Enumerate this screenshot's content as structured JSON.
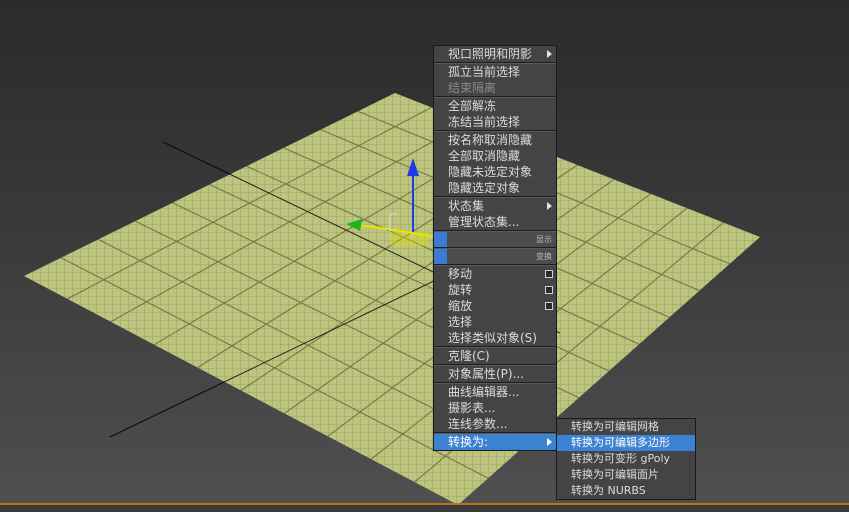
{
  "quad_menu": {
    "group1": [
      {
        "label": "视口照明和阴影",
        "submenu": true,
        "disabled": false
      }
    ],
    "group2": [
      {
        "label": "孤立当前选择",
        "disabled": false
      },
      {
        "label": "结束隔离",
        "disabled": true
      }
    ],
    "group3": [
      {
        "label": "全部解冻",
        "disabled": false
      },
      {
        "label": "冻结当前选择",
        "disabled": false
      }
    ],
    "group4": [
      {
        "label": "按名称取消隐藏",
        "disabled": false
      },
      {
        "label": "全部取消隐藏",
        "disabled": false
      },
      {
        "label": "隐藏未选定对象",
        "disabled": false
      },
      {
        "label": "隐藏选定对象",
        "disabled": false
      }
    ],
    "group5": [
      {
        "label": "状态集",
        "submenu": true,
        "disabled": false
      },
      {
        "label": "管理状态集...",
        "disabled": false
      }
    ],
    "display_header": "显示",
    "transform_header": "变换",
    "transform_items": [
      {
        "label": "移动",
        "options": true
      },
      {
        "label": "旋转",
        "options": true
      },
      {
        "label": "缩放",
        "options": true
      },
      {
        "label": "选择",
        "options": false
      },
      {
        "label": "选择类似对象(S)",
        "options": false
      }
    ],
    "clone": "克隆(C)",
    "object_properties": "对象属性(P)...",
    "group_editors": [
      {
        "label": "曲线编辑器..."
      },
      {
        "label": "摄影表..."
      },
      {
        "label": "连线参数..."
      }
    ],
    "convert_to": "转换为:"
  },
  "convert_submenu": [
    {
      "label": "转换为可编辑网格",
      "highlighted": false
    },
    {
      "label": "转换为可编辑多边形",
      "highlighted": true
    },
    {
      "label": "转换为可变形 gPoly",
      "highlighted": false
    },
    {
      "label": "转换为可编辑面片",
      "highlighted": false
    },
    {
      "label": "转换为 NURBS",
      "highlighted": false
    }
  ],
  "colors": {
    "menu_bg": "#444444",
    "highlight": "#3c82d2",
    "plane_fill": "#a9b36a",
    "gizmo_x": "#e6e600",
    "gizmo_y": "#1db31d",
    "gizmo_z": "#1d3ae6",
    "timeline_accent": "#b07a1c"
  },
  "viewport": {
    "object": "textured-plane",
    "gizmo": "move-transform-gizmo"
  }
}
